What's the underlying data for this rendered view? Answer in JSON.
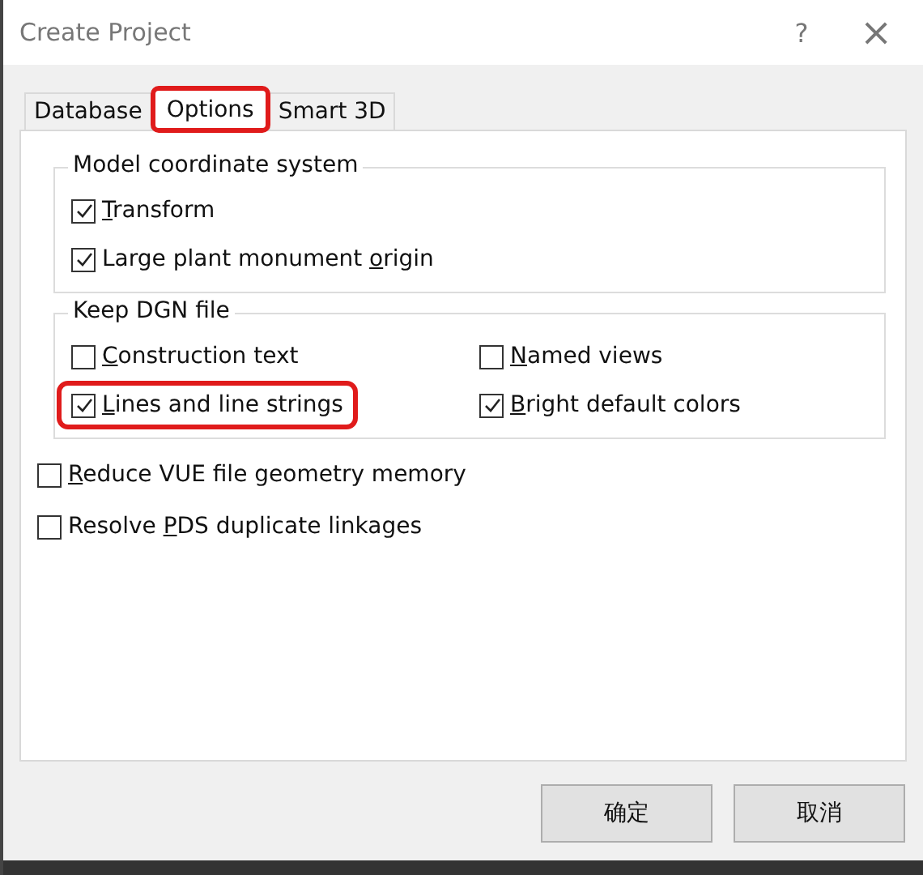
{
  "window": {
    "title": "Create Project",
    "help": "?",
    "close": "×"
  },
  "tabs": [
    {
      "label": "Database",
      "selected": false,
      "highlighted": false
    },
    {
      "label": "Options",
      "selected": true,
      "highlighted": true
    },
    {
      "label": "Smart 3D",
      "selected": false,
      "highlighted": false
    }
  ],
  "groups": [
    {
      "title": "Model coordinate system",
      "options": [
        {
          "key": "T",
          "after": "ransform",
          "checked": true,
          "highlighted": false
        },
        {
          "before": "Large plant monument ",
          "key": "o",
          "after": "rigin",
          "checked": true,
          "highlighted": false
        }
      ]
    },
    {
      "title": "Keep DGN file",
      "options": [
        {
          "key": "C",
          "after": "onstruction text",
          "checked": false,
          "highlighted": false
        },
        {
          "key": "N",
          "after": "amed views",
          "checked": false,
          "highlighted": false
        },
        {
          "key": "L",
          "after": "ines and line strings",
          "checked": true,
          "highlighted": true
        },
        {
          "key": "B",
          "after": "right default colors",
          "checked": true,
          "highlighted": false
        }
      ]
    }
  ],
  "options": [
    {
      "key": "R",
      "after": "educe VUE file geometry memory",
      "checked": false,
      "highlighted": false
    },
    {
      "before": "Resolve ",
      "key": "P",
      "after": "DS duplicate linkages",
      "checked": false,
      "highlighted": false
    }
  ],
  "buttons": [
    "确定",
    "取消"
  ]
}
